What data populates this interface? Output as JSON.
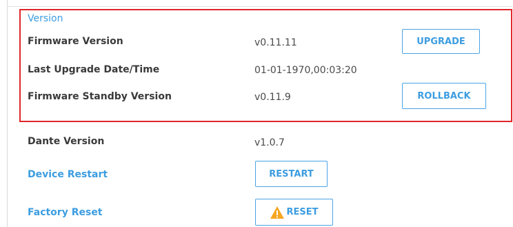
{
  "version_section": {
    "title": "Version",
    "firmware_version": {
      "label": "Firmware Version",
      "value": "v0.11.11",
      "button": "UPGRADE"
    },
    "last_upgrade": {
      "label": "Last Upgrade Date/Time",
      "value": "01-01-1970,00:03:20"
    },
    "standby_version": {
      "label": "Firmware Standby Version",
      "value": "v0.11.9",
      "button": "ROLLBACK"
    }
  },
  "dante_version": {
    "label": "Dante Version",
    "value": "v1.0.7"
  },
  "device_restart": {
    "label": "Device Restart",
    "button": "RESTART"
  },
  "factory_reset": {
    "label": "Factory Reset",
    "button": "RESET",
    "button_icon": "warning-icon"
  },
  "colors": {
    "accent": "#3c9de0",
    "highlight_border": "#e0262b",
    "warning": "#f5a623"
  }
}
